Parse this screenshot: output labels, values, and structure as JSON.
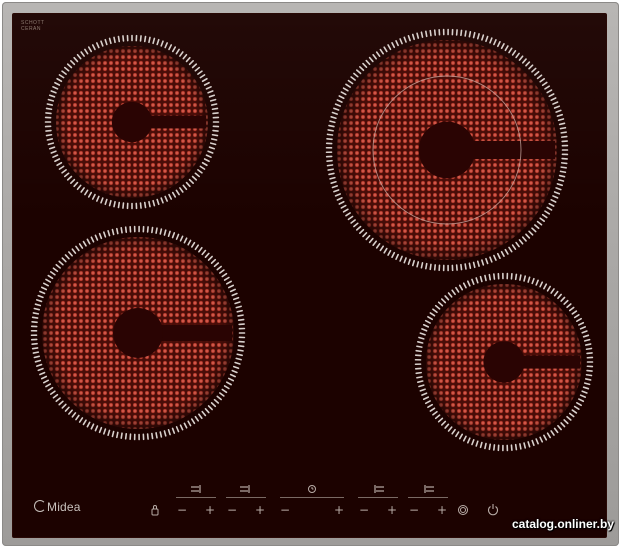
{
  "brand_top": {
    "line1": "SCHOTT",
    "line2": "CERAN"
  },
  "logo": {
    "text": "Midea"
  },
  "watermark": "catalog.onliner.by",
  "icons": {
    "lock": "lock-icon",
    "timer": "clock-icon",
    "power": "power-icon",
    "boost": "boost-icon"
  },
  "controls": {
    "minus": "−",
    "plus": "+"
  },
  "colors": {
    "glass": "#1c0200",
    "element": "#b03a2e",
    "ticks": "#d8d0cc",
    "frame": "#a9a7a5"
  }
}
